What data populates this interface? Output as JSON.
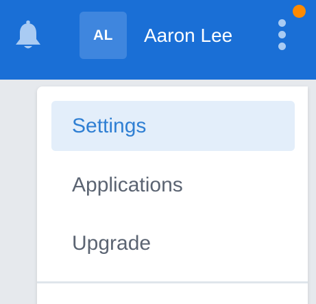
{
  "header": {
    "bell_icon": "bell-icon",
    "avatar_initials": "AL",
    "user_name": "Aaron Lee",
    "more_icon": "more-vertical-icon",
    "notification_indicator": "notification-dot",
    "colors": {
      "bar": "#1a6fd6",
      "avatar": "#3f86de",
      "notification": "#ff8a00"
    }
  },
  "menu": {
    "items": [
      {
        "label": "Settings",
        "active": true
      },
      {
        "label": "Applications",
        "active": false
      },
      {
        "label": "Upgrade",
        "active": false
      }
    ],
    "colors": {
      "active_bg": "#e3eefa",
      "active_text": "#2f7fd3",
      "text": "#5b6472"
    }
  }
}
